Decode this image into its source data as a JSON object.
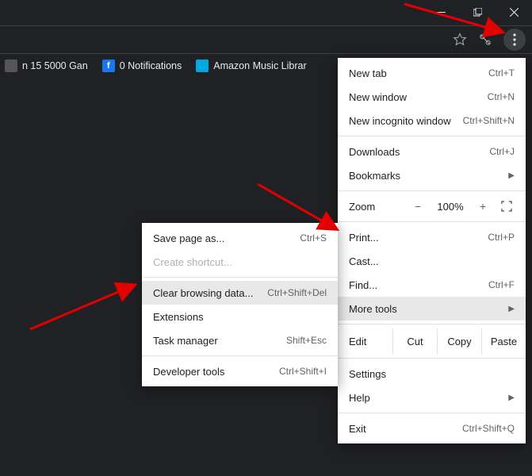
{
  "window_controls": {
    "min": "min",
    "max": "max",
    "close": "close"
  },
  "toolbar": {
    "star": "star",
    "scissor": "screenshot",
    "more": "more"
  },
  "bookmarks": [
    {
      "label": "n 15 5000 Gan",
      "icon_bg": "#555",
      "icon_txt": "",
      "icon_color": "#fff"
    },
    {
      "label": "0 Notifications",
      "icon_bg": "#1877f2",
      "icon_txt": "f",
      "icon_color": "#fff"
    },
    {
      "label": "Amazon Music Librar",
      "icon_bg": "#00a8e1",
      "icon_txt": "",
      "icon_color": "#fff"
    }
  ],
  "menu": {
    "new_tab": {
      "label": "New tab",
      "short": "Ctrl+T"
    },
    "new_window": {
      "label": "New window",
      "short": "Ctrl+N"
    },
    "new_incognito": {
      "label": "New incognito window",
      "short": "Ctrl+Shift+N"
    },
    "downloads": {
      "label": "Downloads",
      "short": "Ctrl+J"
    },
    "bookmarks": {
      "label": "Bookmarks"
    },
    "zoom": {
      "label": "Zoom",
      "value": "100%"
    },
    "print": {
      "label": "Print...",
      "short": "Ctrl+P"
    },
    "cast": {
      "label": "Cast..."
    },
    "find": {
      "label": "Find...",
      "short": "Ctrl+F"
    },
    "more_tools": {
      "label": "More tools"
    },
    "edit": {
      "label": "Edit",
      "cut": "Cut",
      "copy": "Copy",
      "paste": "Paste"
    },
    "settings": {
      "label": "Settings"
    },
    "help": {
      "label": "Help"
    },
    "exit": {
      "label": "Exit",
      "short": "Ctrl+Shift+Q"
    }
  },
  "submenu": {
    "save_page": {
      "label": "Save page as...",
      "short": "Ctrl+S"
    },
    "create_shortcut": {
      "label": "Create shortcut..."
    },
    "clear_data": {
      "label": "Clear browsing data...",
      "short": "Ctrl+Shift+Del"
    },
    "extensions": {
      "label": "Extensions"
    },
    "task_manager": {
      "label": "Task manager",
      "short": "Shift+Esc"
    },
    "dev_tools": {
      "label": "Developer tools",
      "short": "Ctrl+Shift+I"
    }
  },
  "annotation_color": "#e20000"
}
